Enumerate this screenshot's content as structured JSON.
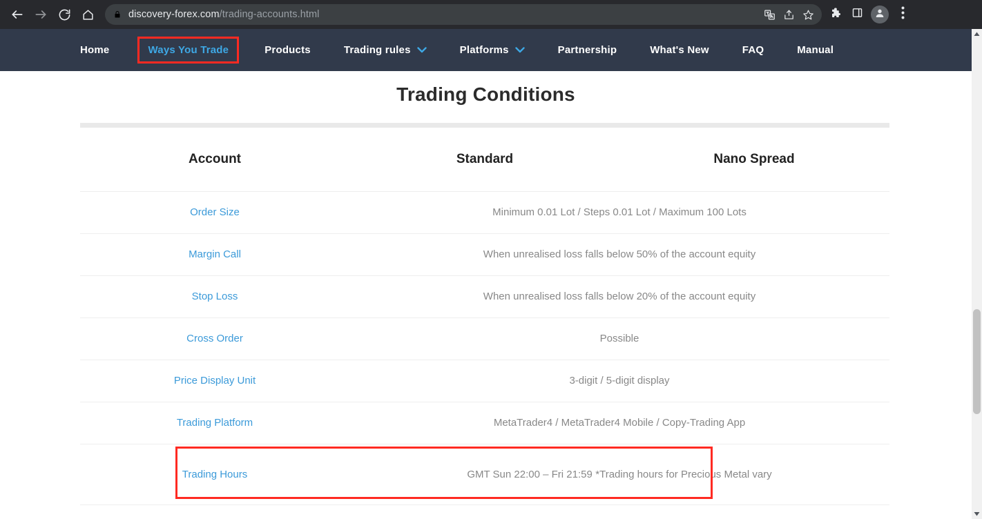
{
  "browser": {
    "url_domain": "discovery-forex.com",
    "url_path": "/trading-accounts.html",
    "icons": {
      "back": "back-arrow-icon",
      "forward": "forward-arrow-icon",
      "reload": "reload-icon",
      "home": "home-icon",
      "lock": "lock-icon",
      "translate": "translate-icon",
      "share": "share-icon",
      "bookmark": "star-icon",
      "extensions": "puzzle-icon",
      "side_panel": "side-panel-icon",
      "profile": "avatar-icon",
      "menu": "three-dot-menu-icon"
    }
  },
  "site_nav": {
    "items": [
      {
        "label": "Home",
        "active": false,
        "dropdown": false
      },
      {
        "label": "Ways You Trade",
        "active": true,
        "dropdown": false
      },
      {
        "label": "Products",
        "active": false,
        "dropdown": false
      },
      {
        "label": "Trading rules",
        "active": false,
        "dropdown": true
      },
      {
        "label": "Platforms",
        "active": false,
        "dropdown": true
      },
      {
        "label": "Partnership",
        "active": false,
        "dropdown": false
      },
      {
        "label": "What's New",
        "active": false,
        "dropdown": false
      },
      {
        "label": "FAQ",
        "active": false,
        "dropdown": false
      },
      {
        "label": "Manual",
        "active": false,
        "dropdown": false
      }
    ],
    "highlight_color": "#ff2a22",
    "active_color": "#3ea8e5",
    "background_color": "#313a4b"
  },
  "page": {
    "title": "Trading Conditions",
    "table": {
      "headers": {
        "account": "Account",
        "standard": "Standard",
        "nano_spread": "Nano Spread"
      },
      "rows": [
        {
          "label": "Order Size",
          "value": "Minimum 0.01 Lot / Steps 0.01 Lot / Maximum 100 Lots"
        },
        {
          "label": "Margin Call",
          "value": "When unrealised loss falls below 50% of the account equity"
        },
        {
          "label": "Stop Loss",
          "value": "When unrealised loss falls below 20% of the account equity"
        },
        {
          "label": "Cross Order",
          "value": "Possible"
        },
        {
          "label": "Price Display Unit",
          "value": "3-digit / 5-digit display"
        },
        {
          "label": "Trading Platform",
          "value": "MetaTrader4 / MetaTrader4 Mobile / Copy-Trading App"
        }
      ],
      "trading_hours_row": {
        "label": "Trading Hours",
        "value": "GMT Sun 22:00 – Fri 21:59",
        "note": "*Trading hours for Precious Metal vary",
        "highlighted": true
      },
      "link_color": "#3b9ad9",
      "value_color": "#888888"
    }
  }
}
